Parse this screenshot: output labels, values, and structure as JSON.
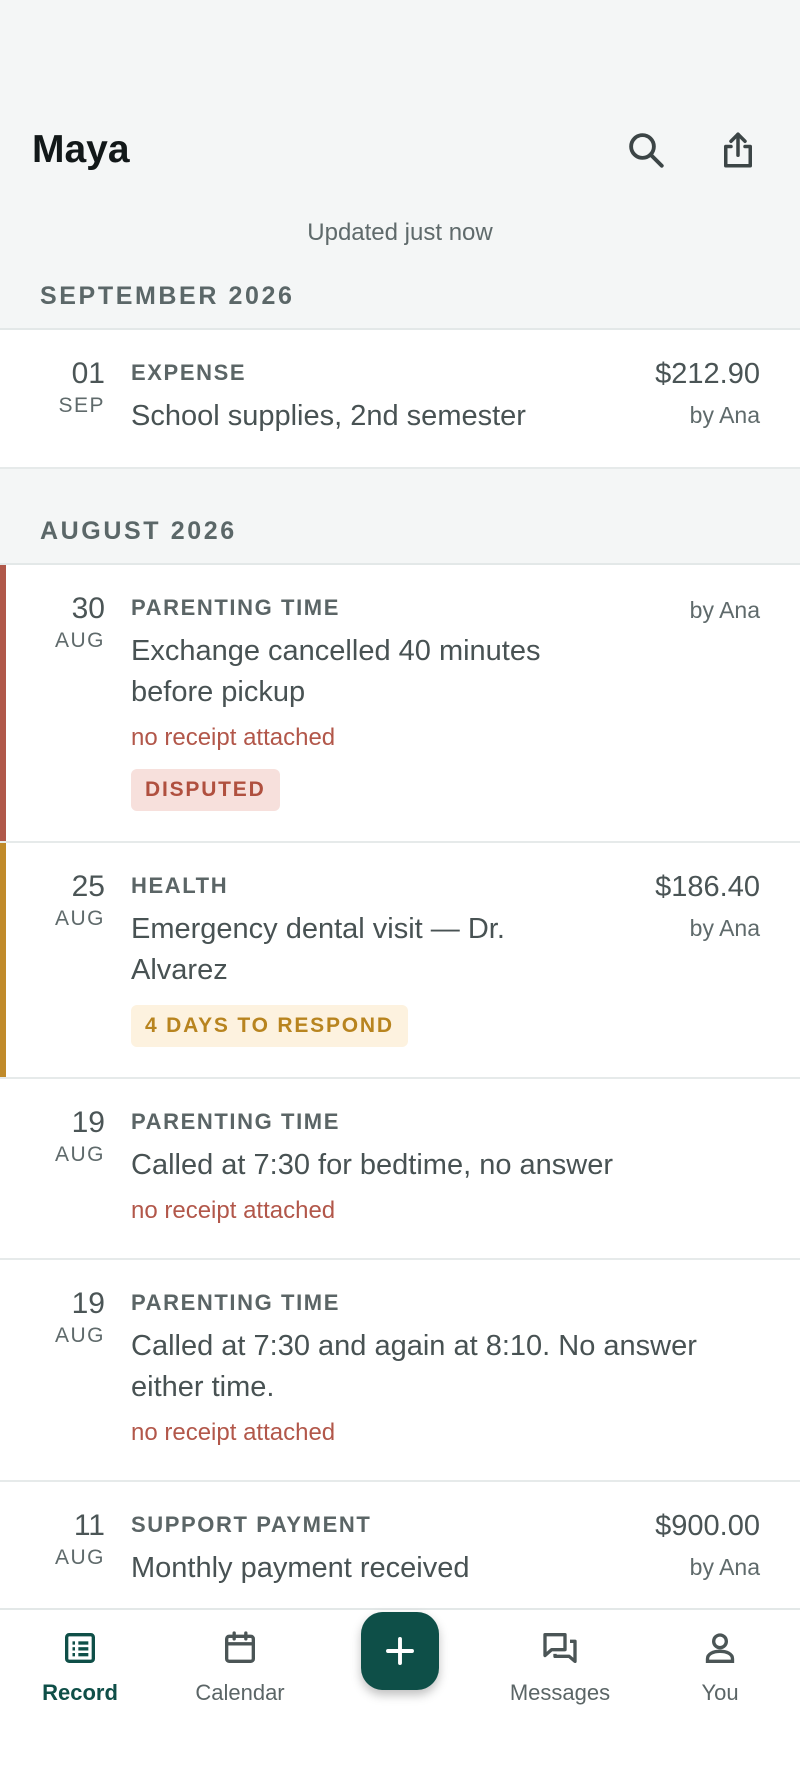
{
  "header": {
    "title": "Maya",
    "search_icon": "search-icon",
    "share_icon": "share-icon"
  },
  "updated_text": "Updated just now",
  "sections": [
    {
      "heading": "SEPTEMBER 2026",
      "entries": [
        {
          "day": "01",
          "month": "SEP",
          "category": "EXPENSE",
          "title": "School supplies, 2nd semester",
          "amount": "$212.90",
          "by": "by Ana"
        }
      ]
    },
    {
      "heading": "AUGUST 2026",
      "entries": [
        {
          "day": "30",
          "month": "AUG",
          "category": "PARENTING TIME",
          "title": "Exchange cancelled 40 minutes before pickup",
          "note": "no receipt attached",
          "badge": "DISPUTED",
          "by": "by Ana",
          "flag_color": "#b0584a"
        },
        {
          "day": "25",
          "month": "AUG",
          "category": "HEALTH",
          "title": "Emergency dental visit — Dr. Alvarez",
          "badge": "4 DAYS TO RESPOND",
          "amount": "$186.40",
          "by": "by Ana",
          "flag_color": "#c08a2a"
        },
        {
          "day": "19",
          "month": "AUG",
          "category": "PARENTING TIME",
          "title": "Called at 7:30 for bedtime, no answer",
          "note": "no receipt attached"
        },
        {
          "day": "19",
          "month": "AUG",
          "category": "PARENTING TIME",
          "title": "Called at 7:30 and again at 8:10. No answer either time.",
          "note": "no receipt attached"
        },
        {
          "day": "11",
          "month": "AUG",
          "category": "SUPPORT PAYMENT",
          "title": "Monthly payment received",
          "amount": "$900.00",
          "by": "by Ana"
        }
      ]
    }
  ],
  "nav": {
    "record": "Record",
    "calendar": "Calendar",
    "messages": "Messages",
    "you": "You",
    "add_icon": "plus-icon"
  },
  "colors": {
    "accent": "#0e4f48",
    "disputed": "#b0584a",
    "pending": "#c08a2a",
    "background": "#f4f6f6"
  }
}
